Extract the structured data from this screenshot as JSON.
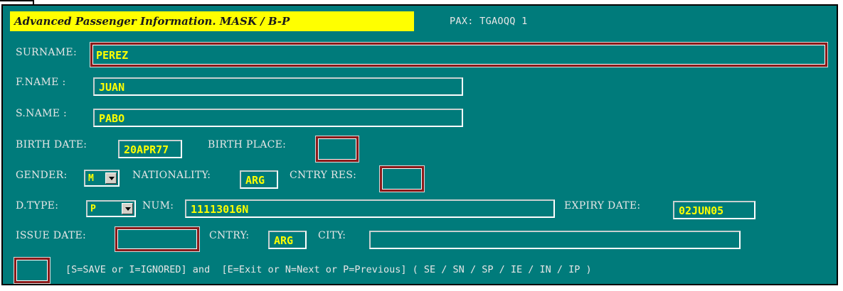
{
  "header": {
    "title": "Advanced Passenger Information. MASK / B-P",
    "pax_label": "PAX: TGAOQQ 1"
  },
  "form": {
    "surname": {
      "label": "SURNAME:",
      "value": "PEREZ"
    },
    "first_name": {
      "label": "F.NAME  :",
      "value": "JUAN"
    },
    "second_name": {
      "label": "S.NAME  :",
      "value": "PABO"
    },
    "birth_date": {
      "label": "BIRTH DATE:",
      "value": "20APR77"
    },
    "birth_place": {
      "label": "BIRTH PLACE:",
      "value": ""
    },
    "gender": {
      "label": "GENDER:",
      "value": "M"
    },
    "nationality": {
      "label": "NATIONALITY:",
      "value": "ARG"
    },
    "country_res": {
      "label": "CNTRY RES:",
      "value": ""
    },
    "doc_type": {
      "label": "D.TYPE:",
      "value": "P"
    },
    "doc_number": {
      "label": "NUM:",
      "value": "11113016N"
    },
    "expiry_date": {
      "label": "EXPIRY DATE:",
      "value": "02JUN05"
    },
    "issue_date": {
      "label": "ISSUE DATE:",
      "value": ""
    },
    "issue_country": {
      "label": "CNTRY:",
      "value": "ARG"
    },
    "issue_city": {
      "label": "CITY:",
      "value": ""
    },
    "action": {
      "value": ""
    }
  },
  "footer": {
    "instructions": "[S=SAVE or I=IGNORED] and  [E=Exit or N=Next or P=Previous] ( SE / SN / SP / IE / IN / IP )"
  },
  "colors": {
    "panel": "#007b7b",
    "title_bg": "#ffff00",
    "value_text": "#ffff00",
    "label_text": "#e6e6e6",
    "required_border": "#8b1a1a"
  }
}
